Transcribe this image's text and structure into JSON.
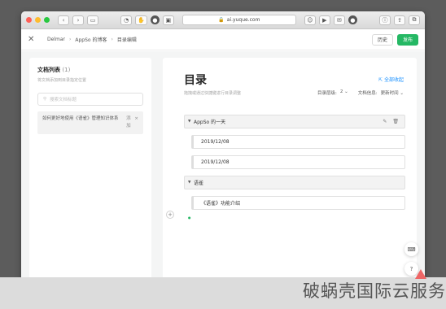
{
  "browser": {
    "url": "ai.yuque.com",
    "colors": {
      "close": "#ff5f57",
      "minimize": "#febc2e",
      "zoom": "#28c840"
    }
  },
  "header": {
    "breadcrumb": [
      "Delmar",
      "AppSo 的博客",
      "目录编辑"
    ],
    "history_label": "历史",
    "publish_label": "发布",
    "publish_color": "#25b864"
  },
  "doc_list": {
    "title": "文档列表",
    "count": "(1)",
    "subtitle": "将文档添加到目录指定位置",
    "search_placeholder": "搜索文档标题",
    "documents": [
      {
        "title": "如何更好地使用《语雀》管理知识体系",
        "add_label": "添加"
      }
    ]
  },
  "toc": {
    "title": "目录",
    "subtitle": "拖拽或通过快捷键进行目录调整",
    "collapse_all": "全部收起",
    "level_label": "目录层级:",
    "level_value": "2",
    "info_label": "文档信息:",
    "info_value": "更新时间",
    "items": [
      {
        "label": "AppSo 的一天",
        "level": 0
      },
      {
        "label": "2019/12/08",
        "level": 1
      },
      {
        "label": "2019/12/08",
        "level": 1
      },
      {
        "label": "语雀",
        "level": 0
      },
      {
        "label": "《语雀》功能介绍",
        "level": 1
      }
    ]
  },
  "help_label": "?",
  "watermark": "破蜗壳国际云服务"
}
